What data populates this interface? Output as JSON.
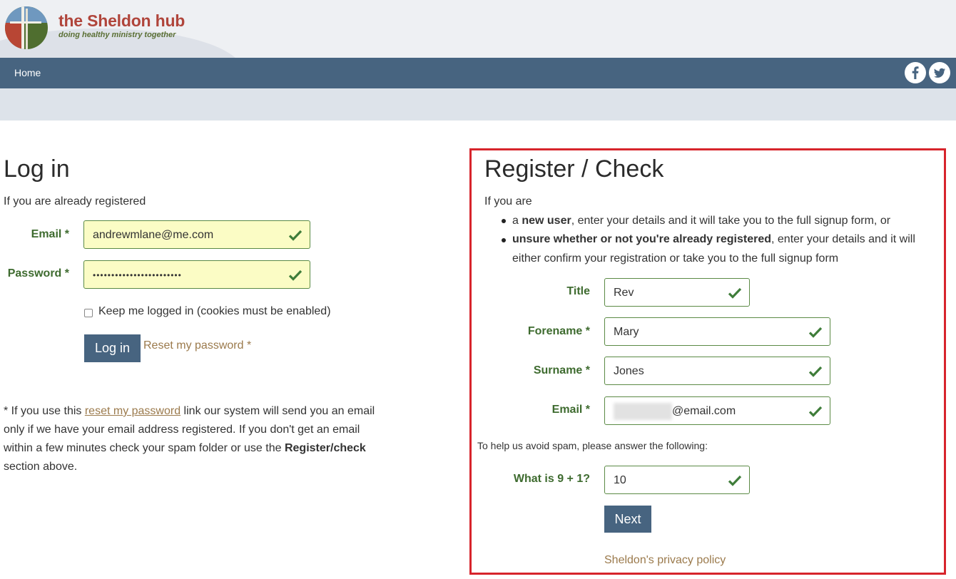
{
  "brand": {
    "name": "the Sheldon hub",
    "tagline": "doing healthy ministry together",
    "colors": {
      "name": "#b0453b",
      "tagline": "#5a6f34",
      "nav": "#476480"
    }
  },
  "nav": {
    "home_label": "Home",
    "social": [
      {
        "icon": "facebook-icon"
      },
      {
        "icon": "twitter-icon"
      }
    ]
  },
  "login": {
    "title": "Log in",
    "intro": "If you are already registered",
    "email_label": "Email *",
    "email_value": "andrewmlane@me.com",
    "password_label": "Password *",
    "password_value": "••••••••••••••••••••••••",
    "keep_logged_in_label": "Keep me logged in (cookies must be enabled)",
    "login_button": "Log in",
    "reset_link": "Reset my password *",
    "note": {
      "prefix": "* If you use this ",
      "link": "reset my password",
      "line1_suffix": " link our system will send you an email",
      "line2": "only if we have your email address registered. If you don't get an email",
      "line3_prefix": "within a few minutes check your spam folder or use the ",
      "line3_bold": "Register/check",
      "line4": "section above."
    }
  },
  "register": {
    "title": "Register / Check",
    "intro": "If you are",
    "bullet1_bold": "new user",
    "bullet1_prefix": "a ",
    "bullet1_rest": ", enter your details and it will take you to the full signup form, or",
    "bullet2_bold": "unsure whether or not you're already registered",
    "bullet2_rest": ", enter your details and it will",
    "bullet2_line2": "either confirm your registration or take you to the full signup form",
    "title_label": "Title",
    "title_value": "Rev",
    "forename_label": "Forename *",
    "forename_value": "Mary",
    "surname_label": "Surname *",
    "surname_value": "Jones",
    "email_label": "Email *",
    "email_value": "@email.com",
    "spam_prompt": "To help us avoid spam, please answer the following:",
    "question_label": "What is 9 + 1?",
    "question_value": "10",
    "next_button": "Next",
    "privacy_link": "Sheldon's privacy policy"
  },
  "colors": {
    "label_green": "#3e6b2f",
    "field_border": "#5b8a45",
    "highlight_border": "#d7242c",
    "link": "#9b7a4c",
    "autofill_yellow": "#fbfcc5"
  }
}
